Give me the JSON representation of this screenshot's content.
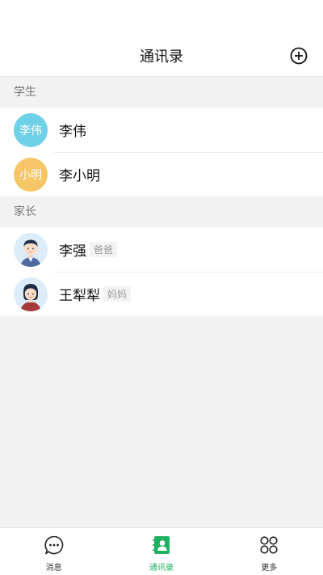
{
  "header": {
    "title": "通讯录",
    "add_icon": "plus-circle-icon"
  },
  "sections": [
    {
      "title": "学生",
      "contacts": [
        {
          "name": "李伟",
          "avatar_text": "李伟",
          "avatar_color": "#6ed1e8"
        },
        {
          "name": "李小明",
          "avatar_text": "小明",
          "avatar_color": "#f5c567"
        }
      ]
    },
    {
      "title": "家长",
      "contacts": [
        {
          "name": "李强",
          "role": "爸爸",
          "avatar_icon": "father-avatar-icon"
        },
        {
          "name": "王犁犁",
          "role": "妈妈",
          "avatar_icon": "mother-avatar-icon"
        }
      ]
    }
  ],
  "tabbar": {
    "items": [
      {
        "label": "消息",
        "icon": "chat-bubble-icon",
        "active": false
      },
      {
        "label": "通讯录",
        "icon": "contacts-book-icon",
        "active": true
      },
      {
        "label": "更多",
        "icon": "grid-more-icon",
        "active": false
      }
    ],
    "active_color": "#1fb160"
  }
}
